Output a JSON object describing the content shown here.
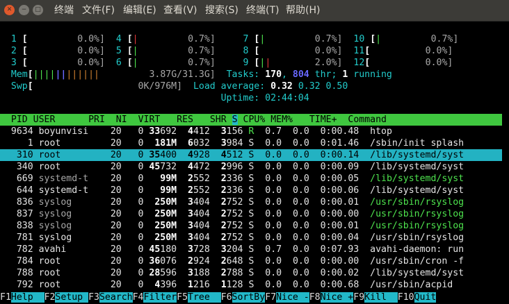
{
  "window": {
    "buttons": {
      "close": "✕",
      "minimize": "−",
      "maximize": "□"
    },
    "menu": [
      "终端",
      "文件(F)",
      "编辑(E)",
      "查看(V)",
      "搜索(S)",
      "终端(T)",
      "帮助(H)"
    ]
  },
  "cpus": [
    {
      "n": "1",
      "pct": "0.0%]"
    },
    {
      "n": "2",
      "pct": "0.0%]"
    },
    {
      "n": "3",
      "pct": "0.0%]"
    },
    {
      "n": "4",
      "pct": "0.7%]"
    },
    {
      "n": "5",
      "pct": "0.7%]"
    },
    {
      "n": "6",
      "pct": "0.7%]"
    },
    {
      "n": "7",
      "pct": "0.7%]"
    },
    {
      "n": "8",
      "pct": "0.0%]"
    },
    {
      "n": "9",
      "pct": "2.0%]"
    },
    {
      "n": "10",
      "pct": "0.7%]"
    },
    {
      "n": "11",
      "pct": "0.0%]"
    },
    {
      "n": "12",
      "pct": "0.0%]"
    }
  ],
  "mem": {
    "label": "Mem",
    "value": "3.87G/31.3G]"
  },
  "swp": {
    "label": "Swp",
    "value": "0K/976M]"
  },
  "tasks": {
    "label": "Tasks: ",
    "count": "170",
    "sep": ", ",
    "thr": "804",
    "thr_label": " thr; ",
    "running": "1",
    "running_label": " running"
  },
  "load": {
    "label": "Load average: ",
    "l1": "0.32",
    "l5": "0.32",
    "l15": "0.50"
  },
  "uptime": {
    "label": "Uptime: ",
    "value": "02:44:04"
  },
  "columns": {
    "pid": "PID",
    "user": "USER",
    "pri": "PRI",
    "ni": "NI",
    "virt": "VIRT",
    "res": "RES",
    "shr": "SHR",
    "s": "S",
    "cpu": "CPU%",
    "mem": "MEM%",
    "time": "TIME+",
    "cmd": "Command"
  },
  "processes": [
    {
      "pid": "9634",
      "user": "boyunvisi",
      "pri": "20",
      "ni": "0",
      "virtA": "33",
      "virtB": "692",
      "resA": "4",
      "resB": "412",
      "shrA": "3",
      "shrB": "156",
      "s": "R",
      "cpu": "0.7",
      "mem": "0.0",
      "timeA": "0:00.",
      "timeB": "48",
      "cmd": "htop",
      "thread": false
    },
    {
      "pid": "1",
      "user": "root",
      "pri": "20",
      "ni": "0",
      "virtA": "",
      "virtB": "181M",
      "resA": "6",
      "resB": "032",
      "shrA": "3",
      "shrB": "984",
      "s": "S",
      "cpu": "0.0",
      "mem": "0.0",
      "timeA": "0:01.",
      "timeB": "46",
      "cmd": "/sbin/init splash",
      "thread": false
    },
    {
      "pid": "310",
      "user": "root",
      "pri": "20",
      "ni": "0",
      "virtA": "35",
      "virtB": "400",
      "resA": "4",
      "resB": "928",
      "shrA": "4",
      "shrB": "512",
      "s": "S",
      "cpu": "0.0",
      "mem": "0.0",
      "timeA": "0:00.",
      "timeB": "14",
      "cmd": "/lib/systemd/syst",
      "thread": false,
      "selected": true
    },
    {
      "pid": "340",
      "user": "root",
      "pri": "20",
      "ni": "0",
      "virtA": "45",
      "virtB": "732",
      "resA": "4",
      "resB": "472",
      "shrA": "2",
      "shrB": "996",
      "s": "S",
      "cpu": "0.0",
      "mem": "0.0",
      "timeA": "0:00.",
      "timeB": "09",
      "cmd": "/lib/systemd/syst",
      "thread": false
    },
    {
      "pid": "669",
      "user": "systemd-t",
      "pri": "20",
      "ni": "0",
      "virtA": "",
      "virtB": "99M",
      "resA": "2",
      "resB": "552",
      "shrA": "2",
      "shrB": "336",
      "s": "S",
      "cpu": "0.0",
      "mem": "0.0",
      "timeA": "0:00.",
      "timeB": "05",
      "cmd": "/lib/systemd/syst",
      "thread": true
    },
    {
      "pid": "644",
      "user": "systemd-t",
      "pri": "20",
      "ni": "0",
      "virtA": "",
      "virtB": "99M",
      "resA": "2",
      "resB": "552",
      "shrA": "2",
      "shrB": "336",
      "s": "S",
      "cpu": "0.0",
      "mem": "0.0",
      "timeA": "0:00.",
      "timeB": "06",
      "cmd": "/lib/systemd/syst",
      "thread": false
    },
    {
      "pid": "836",
      "user": "syslog",
      "pri": "20",
      "ni": "0",
      "virtA": "",
      "virtB": "250M",
      "resA": "3",
      "resB": "404",
      "shrA": "2",
      "shrB": "752",
      "s": "S",
      "cpu": "0.0",
      "mem": "0.0",
      "timeA": "0:00.",
      "timeB": "01",
      "cmd": "/usr/sbin/rsyslog",
      "thread": true
    },
    {
      "pid": "837",
      "user": "syslog",
      "pri": "20",
      "ni": "0",
      "virtA": "",
      "virtB": "250M",
      "resA": "3",
      "resB": "404",
      "shrA": "2",
      "shrB": "752",
      "s": "S",
      "cpu": "0.0",
      "mem": "0.0",
      "timeA": "0:00.",
      "timeB": "00",
      "cmd": "/usr/sbin/rsyslog",
      "thread": true
    },
    {
      "pid": "838",
      "user": "syslog",
      "pri": "20",
      "ni": "0",
      "virtA": "",
      "virtB": "250M",
      "resA": "3",
      "resB": "404",
      "shrA": "2",
      "shrB": "752",
      "s": "S",
      "cpu": "0.0",
      "mem": "0.0",
      "timeA": "0:00.",
      "timeB": "01",
      "cmd": "/usr/sbin/rsyslog",
      "thread": true
    },
    {
      "pid": "781",
      "user": "syslog",
      "pri": "20",
      "ni": "0",
      "virtA": "",
      "virtB": "250M",
      "resA": "3",
      "resB": "404",
      "shrA": "2",
      "shrB": "752",
      "s": "S",
      "cpu": "0.0",
      "mem": "0.0",
      "timeA": "0:00.",
      "timeB": "04",
      "cmd": "/usr/sbin/rsyslog",
      "thread": false
    },
    {
      "pid": "782",
      "user": "avahi",
      "pri": "20",
      "ni": "0",
      "virtA": "45",
      "virtB": "180",
      "resA": "3",
      "resB": "728",
      "shrA": "3",
      "shrB": "204",
      "s": "S",
      "cpu": "0.7",
      "mem": "0.0",
      "timeA": "0:07.",
      "timeB": "93",
      "cmd": "avahi-daemon: run",
      "thread": false
    },
    {
      "pid": "784",
      "user": "root",
      "pri": "20",
      "ni": "0",
      "virtA": "36",
      "virtB": "076",
      "resA": "2",
      "resB": "924",
      "shrA": "2",
      "shrB": "648",
      "s": "S",
      "cpu": "0.0",
      "mem": "0.0",
      "timeA": "0:00.",
      "timeB": "00",
      "cmd": "/usr/sbin/cron -f",
      "thread": false
    },
    {
      "pid": "788",
      "user": "root",
      "pri": "20",
      "ni": "0",
      "virtA": "28",
      "virtB": "596",
      "resA": "3",
      "resB": "188",
      "shrA": "2",
      "shrB": "788",
      "s": "S",
      "cpu": "0.0",
      "mem": "0.0",
      "timeA": "0:00.",
      "timeB": "02",
      "cmd": "/lib/systemd/syst",
      "thread": false
    },
    {
      "pid": "792",
      "user": "root",
      "pri": "20",
      "ni": "0",
      "virtA": "4",
      "virtB": "396",
      "resA": "1",
      "resB": "216",
      "shrA": "1",
      "shrB": "128",
      "s": "S",
      "cpu": "0.0",
      "mem": "0.0",
      "timeA": "0:00.",
      "timeB": "68",
      "cmd": "/usr/sbin/acpid",
      "thread": false
    }
  ],
  "fkeys": [
    {
      "key": "F1",
      "label": "Help  "
    },
    {
      "key": "F2",
      "label": "Setup "
    },
    {
      "key": "F3",
      "label": "Search"
    },
    {
      "key": "F4",
      "label": "Filter"
    },
    {
      "key": "F5",
      "label": "Tree  "
    },
    {
      "key": "F6",
      "label": "SortBy"
    },
    {
      "key": "F7",
      "label": "Nice -"
    },
    {
      "key": "F8",
      "label": "Nice +"
    },
    {
      "key": "F9",
      "label": "Kill  "
    },
    {
      "key": "F10",
      "label": "Quit"
    }
  ],
  "colors": {
    "green": "#4ee44e",
    "cyan": "#22b8c8",
    "blue": "#6868ff",
    "titlebar": "#3c3b37"
  }
}
